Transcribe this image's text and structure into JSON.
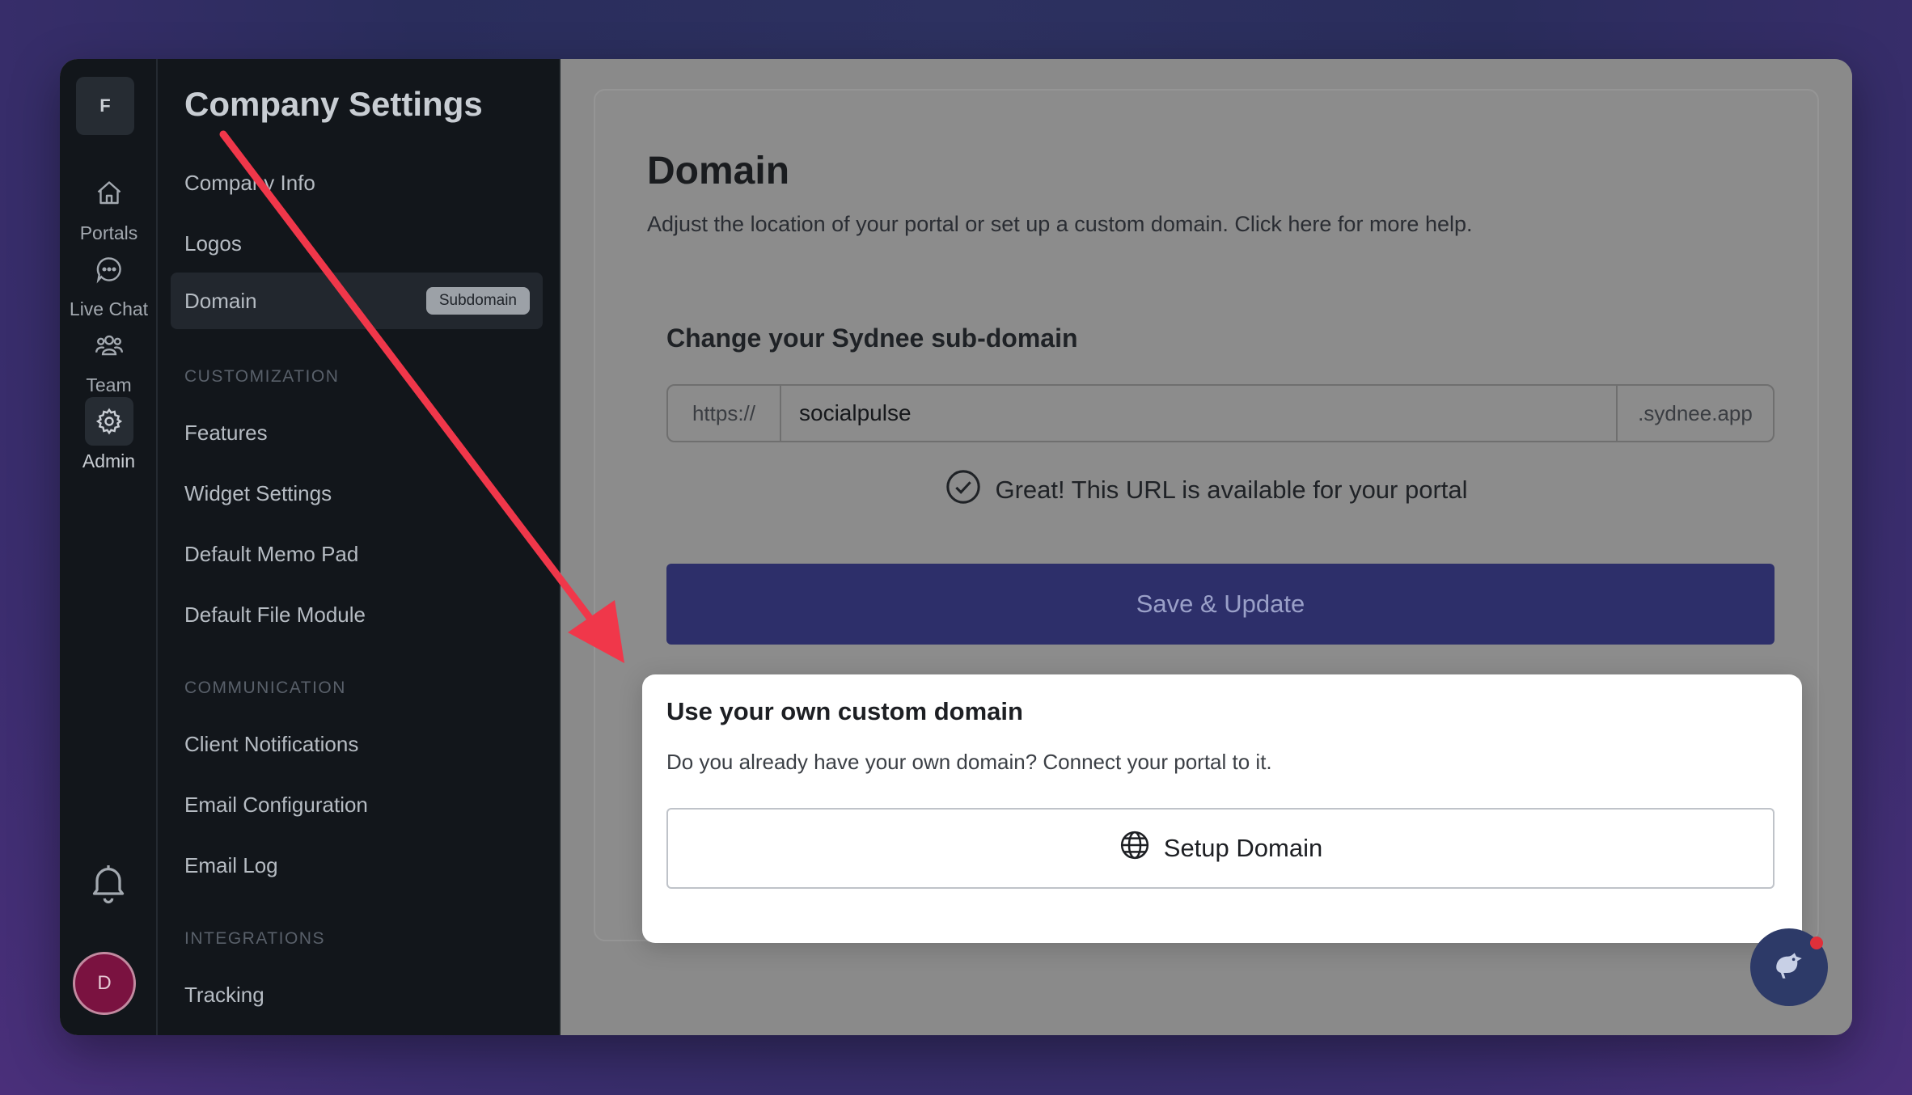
{
  "rail": {
    "workspace_initial": "F",
    "items": [
      {
        "label": "Portals",
        "icon": "home-icon"
      },
      {
        "label": "Live Chat",
        "icon": "chat-bubble-icon"
      },
      {
        "label": "Team",
        "icon": "team-icon"
      },
      {
        "label": "Admin",
        "icon": "gear-icon",
        "active": true
      }
    ],
    "avatar_initial": "D"
  },
  "nav": {
    "title": "Company Settings",
    "items": [
      {
        "label": "Company Info"
      },
      {
        "label": "Logos"
      },
      {
        "label": "Domain",
        "badge": "Subdomain",
        "active": true
      }
    ],
    "sections": [
      {
        "title": "CUSTOMIZATION",
        "items": [
          "Features",
          "Widget Settings",
          "Default Memo Pad",
          "Default File Module"
        ]
      },
      {
        "title": "COMMUNICATION",
        "items": [
          "Client Notifications",
          "Email Configuration",
          "Email Log"
        ]
      },
      {
        "title": "INTEGRATIONS",
        "items": [
          "Tracking"
        ]
      }
    ]
  },
  "main": {
    "title": "Domain",
    "subtitle": "Adjust the location of your portal or set up a custom domain. Click here for more help.",
    "subdomain_heading": "Change your Sydnee sub-domain",
    "url_prefix": "https://",
    "url_value": "socialpulse",
    "url_suffix": ".sydnee.app",
    "availability": "Great! This URL is available for your portal",
    "save_label": "Save & Update"
  },
  "custom_domain": {
    "heading": "Use your own custom domain",
    "description": "Do you already have your own domain? Connect your portal to it.",
    "button_label": "Setup Domain"
  },
  "colors": {
    "accent": "#2d2f6a",
    "annotation_arrow": "#f0374a",
    "chat_fab": "#2d3a68"
  }
}
